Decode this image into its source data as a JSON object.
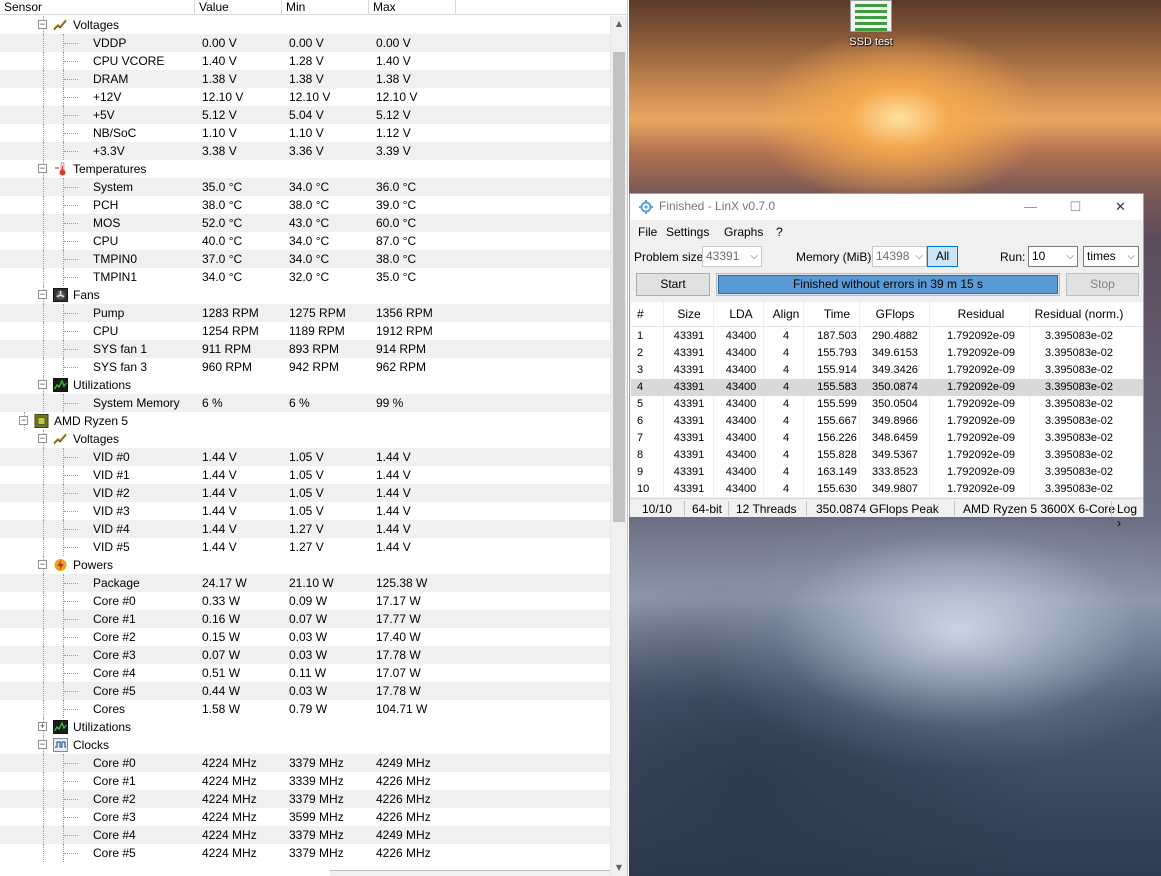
{
  "hwmonitor": {
    "columns": [
      "Sensor",
      "Value",
      "Min",
      "Max"
    ],
    "rows": [
      {
        "kind": "group",
        "level": 2,
        "icon": "voltage-icon",
        "label": "Voltages"
      },
      {
        "kind": "sensor",
        "name": "VDDP",
        "value": "0.00 V",
        "min": "0.00 V",
        "max": "0.00 V"
      },
      {
        "kind": "sensor",
        "name": "CPU VCORE",
        "value": "1.40 V",
        "min": "1.28 V",
        "max": "1.40 V"
      },
      {
        "kind": "sensor",
        "name": "DRAM",
        "value": "1.38 V",
        "min": "1.38 V",
        "max": "1.38 V"
      },
      {
        "kind": "sensor",
        "name": "+12V",
        "value": "12.10 V",
        "min": "12.10 V",
        "max": "12.10 V"
      },
      {
        "kind": "sensor",
        "name": "+5V",
        "value": "5.12 V",
        "min": "5.04 V",
        "max": "5.12 V"
      },
      {
        "kind": "sensor",
        "name": "NB/SoC",
        "value": "1.10 V",
        "min": "1.10 V",
        "max": "1.12 V"
      },
      {
        "kind": "sensor",
        "name": "+3.3V",
        "value": "3.38 V",
        "min": "3.36 V",
        "max": "3.39 V"
      },
      {
        "kind": "group",
        "level": 2,
        "icon": "thermometer-icon",
        "label": "Temperatures"
      },
      {
        "kind": "sensor",
        "name": "System",
        "value": "35.0 °C",
        "min": "34.0 °C",
        "max": "36.0 °C"
      },
      {
        "kind": "sensor",
        "name": "PCH",
        "value": "38.0 °C",
        "min": "38.0 °C",
        "max": "39.0 °C"
      },
      {
        "kind": "sensor",
        "name": "MOS",
        "value": "52.0 °C",
        "min": "43.0 °C",
        "max": "60.0 °C"
      },
      {
        "kind": "sensor",
        "name": "CPU",
        "value": "40.0 °C",
        "min": "34.0 °C",
        "max": "87.0 °C"
      },
      {
        "kind": "sensor",
        "name": "TMPIN0",
        "value": "37.0 °C",
        "min": "34.0 °C",
        "max": "38.0 °C"
      },
      {
        "kind": "sensor",
        "name": "TMPIN1",
        "value": "34.0 °C",
        "min": "32.0 °C",
        "max": "35.0 °C"
      },
      {
        "kind": "group",
        "level": 2,
        "icon": "fan-icon",
        "label": "Fans"
      },
      {
        "kind": "sensor",
        "name": "Pump",
        "value": "1283 RPM",
        "min": "1275 RPM",
        "max": "1356 RPM"
      },
      {
        "kind": "sensor",
        "name": "CPU",
        "value": "1254 RPM",
        "min": "1189 RPM",
        "max": "1912 RPM"
      },
      {
        "kind": "sensor",
        "name": "SYS fan 1",
        "value": "911 RPM",
        "min": "893 RPM",
        "max": "914 RPM"
      },
      {
        "kind": "sensor",
        "name": "SYS fan 3",
        "value": "960 RPM",
        "min": "942 RPM",
        "max": "962 RPM"
      },
      {
        "kind": "group",
        "level": 2,
        "icon": "utilization-icon",
        "label": "Utilizations"
      },
      {
        "kind": "sensor",
        "name": "System Memory",
        "value": "6 %",
        "min": "6 %",
        "max": "99 %"
      },
      {
        "kind": "group",
        "level": 1,
        "icon": "cpu-chip-icon",
        "label": "AMD Ryzen 5"
      },
      {
        "kind": "group",
        "level": 2,
        "icon": "voltage-icon",
        "label": "Voltages"
      },
      {
        "kind": "sensor",
        "name": "VID #0",
        "value": "1.44 V",
        "min": "1.05 V",
        "max": "1.44 V"
      },
      {
        "kind": "sensor",
        "name": "VID #1",
        "value": "1.44 V",
        "min": "1.05 V",
        "max": "1.44 V"
      },
      {
        "kind": "sensor",
        "name": "VID #2",
        "value": "1.44 V",
        "min": "1.05 V",
        "max": "1.44 V"
      },
      {
        "kind": "sensor",
        "name": "VID #3",
        "value": "1.44 V",
        "min": "1.05 V",
        "max": "1.44 V"
      },
      {
        "kind": "sensor",
        "name": "VID #4",
        "value": "1.44 V",
        "min": "1.27 V",
        "max": "1.44 V"
      },
      {
        "kind": "sensor",
        "name": "VID #5",
        "value": "1.44 V",
        "min": "1.27 V",
        "max": "1.44 V"
      },
      {
        "kind": "group",
        "level": 2,
        "icon": "power-icon",
        "label": "Powers"
      },
      {
        "kind": "sensor",
        "name": "Package",
        "value": "24.17 W",
        "min": "21.10 W",
        "max": "125.38 W"
      },
      {
        "kind": "sensor",
        "name": "Core #0",
        "value": "0.33 W",
        "min": "0.09 W",
        "max": "17.17 W"
      },
      {
        "kind": "sensor",
        "name": "Core #1",
        "value": "0.16 W",
        "min": "0.07 W",
        "max": "17.77 W"
      },
      {
        "kind": "sensor",
        "name": "Core #2",
        "value": "0.15 W",
        "min": "0.03 W",
        "max": "17.40 W"
      },
      {
        "kind": "sensor",
        "name": "Core #3",
        "value": "0.07 W",
        "min": "0.03 W",
        "max": "17.78 W"
      },
      {
        "kind": "sensor",
        "name": "Core #4",
        "value": "0.51 W",
        "min": "0.11 W",
        "max": "17.07 W"
      },
      {
        "kind": "sensor",
        "name": "Core #5",
        "value": "0.44 W",
        "min": "0.03 W",
        "max": "17.78 W"
      },
      {
        "kind": "sensor",
        "name": "Cores",
        "value": "1.58 W",
        "min": "0.79 W",
        "max": "104.71 W"
      },
      {
        "kind": "group",
        "level": 2,
        "icon": "utilization-icon",
        "label": "Utilizations",
        "collapsed": true
      },
      {
        "kind": "group",
        "level": 2,
        "icon": "clock-icon",
        "label": "Clocks"
      },
      {
        "kind": "sensor",
        "name": "Core #0",
        "value": "4224 MHz",
        "min": "3379 MHz",
        "max": "4249 MHz"
      },
      {
        "kind": "sensor",
        "name": "Core #1",
        "value": "4224 MHz",
        "min": "3339 MHz",
        "max": "4226 MHz"
      },
      {
        "kind": "sensor",
        "name": "Core #2",
        "value": "4224 MHz",
        "min": "3379 MHz",
        "max": "4226 MHz"
      },
      {
        "kind": "sensor",
        "name": "Core #3",
        "value": "4224 MHz",
        "min": "3599 MHz",
        "max": "4226 MHz"
      },
      {
        "kind": "sensor",
        "name": "Core #4",
        "value": "4224 MHz",
        "min": "3379 MHz",
        "max": "4249 MHz"
      },
      {
        "kind": "sensor",
        "name": "Core #5",
        "value": "4224 MHz",
        "min": "3379 MHz",
        "max": "4226 MHz"
      }
    ]
  },
  "desktop": {
    "icon_label": "SSD test",
    "icon_name": "ssd-test-shortcut-icon"
  },
  "linx": {
    "title": "Finished - LinX v0.7.0",
    "window_buttons": {
      "minimize": "—",
      "maximize": "☐",
      "close": "✕"
    },
    "menu": [
      "File",
      "Settings",
      "Graphs",
      "?"
    ],
    "problem_size_label": "Problem size:",
    "problem_size_value": "43391",
    "memory_label": "Memory (MiB):",
    "memory_value": "14398",
    "all_label": "All",
    "run_label": "Run:",
    "run_value": "10",
    "run_unit": "times",
    "start_label": "Start",
    "stop_label": "Stop",
    "progress_text": "Finished without errors in 39 m 15 s",
    "progress_fraction": 1.0,
    "progress_color": "#5a9bd5",
    "table_headers": [
      "#",
      "Size",
      "LDA",
      "Align",
      "Time",
      "GFlops",
      "Residual",
      "Residual (norm.)"
    ],
    "table_rows": [
      [
        "1",
        "43391",
        "43400",
        "4",
        "187.503",
        "290.4882",
        "1.792092e-09",
        "3.395083e-02"
      ],
      [
        "2",
        "43391",
        "43400",
        "4",
        "155.793",
        "349.6153",
        "1.792092e-09",
        "3.395083e-02"
      ],
      [
        "3",
        "43391",
        "43400",
        "4",
        "155.914",
        "349.3426",
        "1.792092e-09",
        "3.395083e-02"
      ],
      [
        "4",
        "43391",
        "43400",
        "4",
        "155.583",
        "350.0874",
        "1.792092e-09",
        "3.395083e-02"
      ],
      [
        "5",
        "43391",
        "43400",
        "4",
        "155.599",
        "350.0504",
        "1.792092e-09",
        "3.395083e-02"
      ],
      [
        "6",
        "43391",
        "43400",
        "4",
        "155.667",
        "349.8966",
        "1.792092e-09",
        "3.395083e-02"
      ],
      [
        "7",
        "43391",
        "43400",
        "4",
        "156.226",
        "348.6459",
        "1.792092e-09",
        "3.395083e-02"
      ],
      [
        "8",
        "43391",
        "43400",
        "4",
        "155.828",
        "349.5367",
        "1.792092e-09",
        "3.395083e-02"
      ],
      [
        "9",
        "43391",
        "43400",
        "4",
        "163.149",
        "333.8523",
        "1.792092e-09",
        "3.395083e-02"
      ],
      [
        "10",
        "43391",
        "43400",
        "4",
        "155.630",
        "349.9807",
        "1.792092e-09",
        "3.395083e-02"
      ]
    ],
    "selected_row": 4,
    "status": {
      "runs": "10/10",
      "bits": "64-bit",
      "threads": "12 Threads",
      "peak": "350.0874 GFlops Peak",
      "cpu": "AMD Ryzen 5 3600X 6-Core",
      "log": "Log ›"
    }
  }
}
